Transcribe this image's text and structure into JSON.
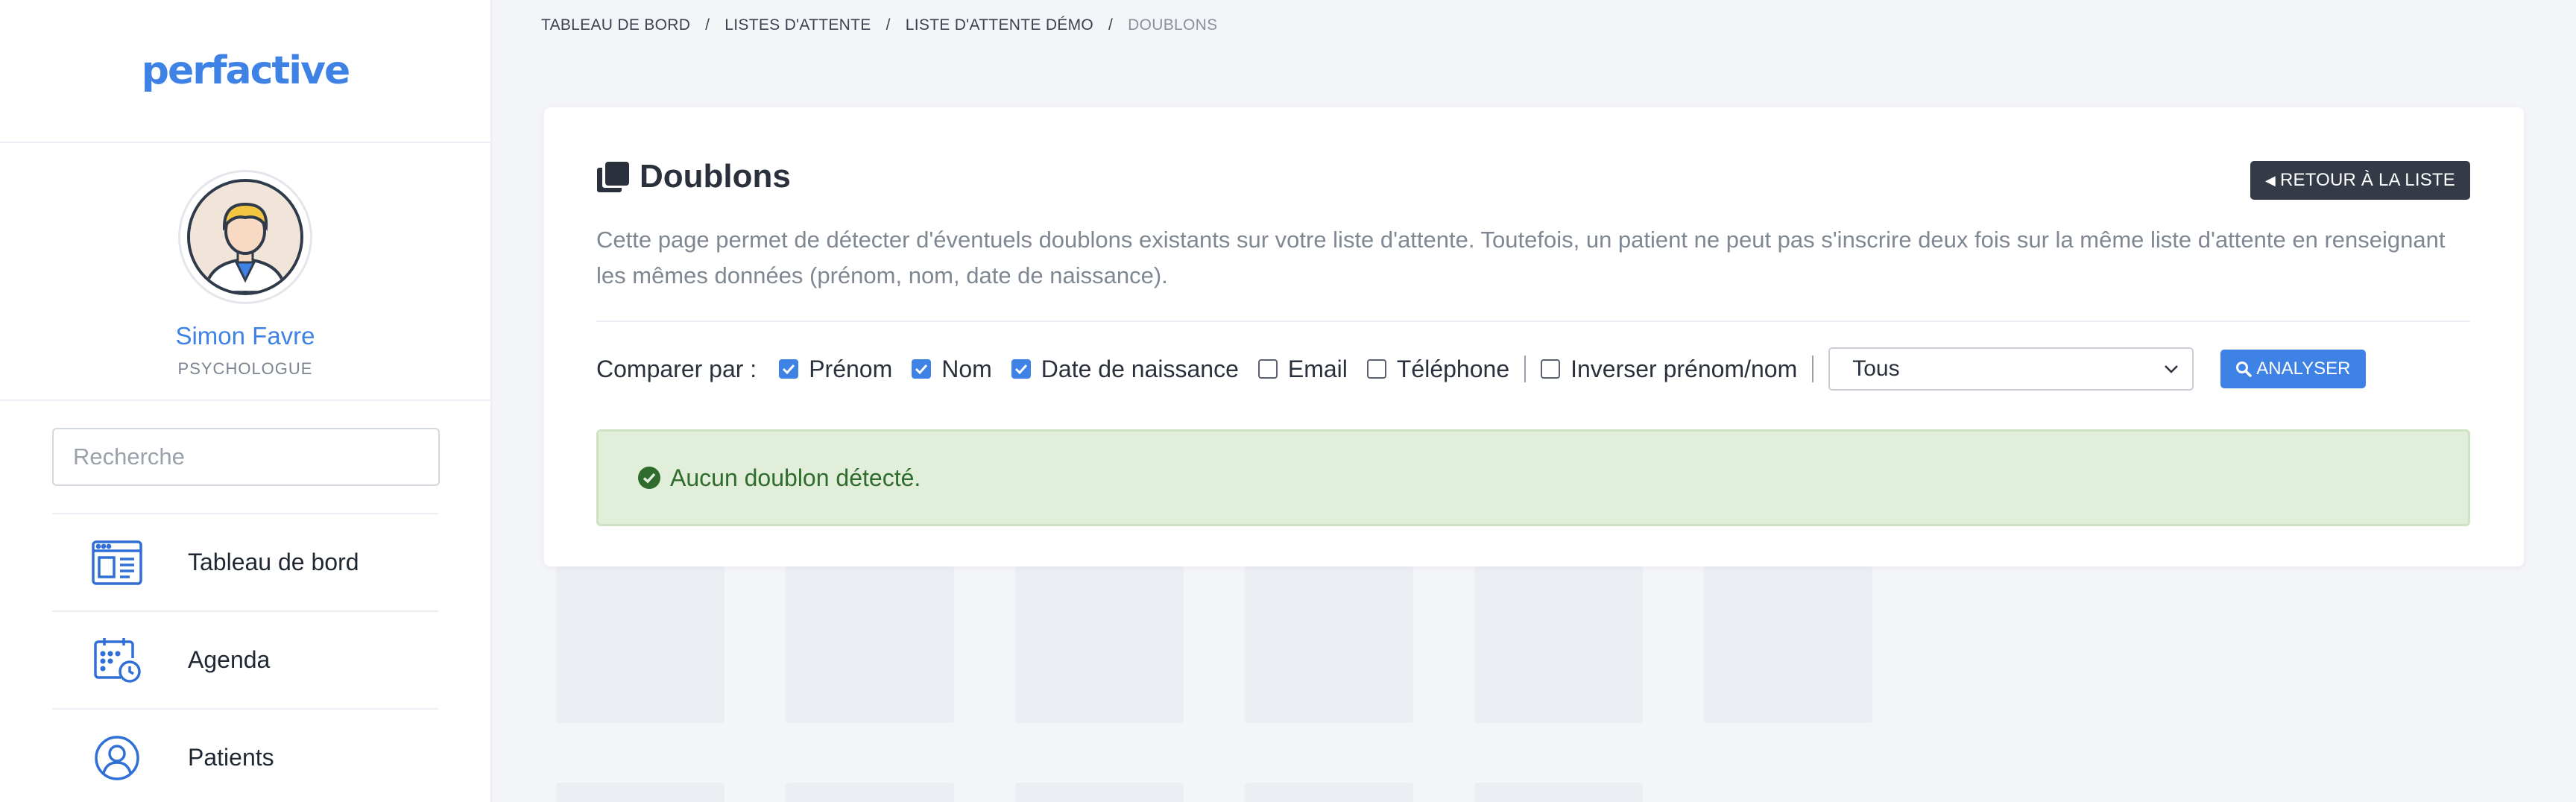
{
  "brand": {
    "logo_text": "perfactive",
    "accent": "#3f82e6"
  },
  "profile": {
    "name": "Simon Favre",
    "role": "PSYCHOLOGUE"
  },
  "sidebar": {
    "search": {
      "placeholder": "Recherche",
      "value": ""
    },
    "items": [
      {
        "label": "Tableau de bord",
        "icon": "dashboard-icon"
      },
      {
        "label": "Agenda",
        "icon": "calendar-clock-icon"
      },
      {
        "label": "Patients",
        "icon": "user-circle-icon"
      }
    ]
  },
  "breadcrumb": {
    "items": [
      "TABLEAU DE BORD",
      "LISTES D'ATTENTE",
      "LISTE D'ATTENTE DÉMO"
    ],
    "current": "DOUBLONS",
    "separator": "/"
  },
  "card": {
    "title": "Doublons",
    "title_icon": "copy-icon",
    "back_button": "RETOUR À LA LISTE",
    "description": "Cette page permet de détecter d'éventuels doublons existants sur votre liste d'attente. Toutefois, un patient ne peut pas s'inscrire deux fois sur la même liste d'attente en renseignant les mêmes données (prénom, nom, date de naissance).",
    "compare": {
      "label": "Comparer par :",
      "options": [
        {
          "label": "Prénom",
          "checked": true
        },
        {
          "label": "Nom",
          "checked": true
        },
        {
          "label": "Date de naissance",
          "checked": true
        },
        {
          "label": "Email",
          "checked": false
        },
        {
          "label": "Téléphone",
          "checked": false
        }
      ],
      "invert": {
        "label": "Inverser prénom/nom",
        "checked": false
      },
      "select_value": "Tous",
      "analyse_button": "ANALYSER"
    },
    "alert": {
      "text": "Aucun doublon détecté.",
      "icon": "check-circle-icon",
      "color": "#2f6b2d"
    }
  }
}
